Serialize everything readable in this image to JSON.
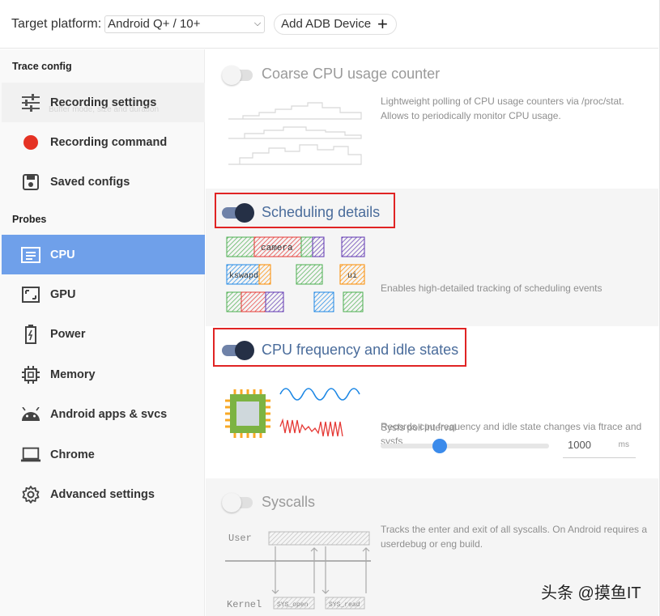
{
  "topbar": {
    "platform_label": "Target platform:",
    "platform_value": "Android Q+ / 10+",
    "add_adb_label": "Add ADB Device"
  },
  "sidebar": {
    "trace_config_title": "Trace config",
    "probes_title": "Probes",
    "ghost_subtitle": "Buffer mode, size and duration",
    "trace_items": [
      {
        "label": "Recording settings",
        "icon": "sliders-icon"
      },
      {
        "label": "Recording command",
        "icon": "record-dot-icon"
      },
      {
        "label": "Saved configs",
        "icon": "save-icon"
      }
    ],
    "probe_items": [
      {
        "label": "CPU",
        "icon": "cpu-icon",
        "active": true
      },
      {
        "label": "GPU",
        "icon": "gpu-icon"
      },
      {
        "label": "Power",
        "icon": "battery-icon"
      },
      {
        "label": "Memory",
        "icon": "memory-chip-icon"
      },
      {
        "label": "Android apps & svcs",
        "icon": "android-icon"
      },
      {
        "label": "Chrome",
        "icon": "laptop-icon"
      },
      {
        "label": "Advanced settings",
        "icon": "gear-icon"
      }
    ]
  },
  "probes": {
    "coarse": {
      "title": "Coarse CPU usage counter",
      "enabled": false,
      "description": "Lightweight polling of CPU usage counters via /proc/stat. Allows to periodically monitor CPU usage."
    },
    "scheduling": {
      "title": "Scheduling details",
      "enabled": true,
      "description": "Enables high-detailed tracking of scheduling events",
      "illus_labels": [
        "camera",
        "kswapd",
        "ui"
      ]
    },
    "cpufreq": {
      "title": "CPU frequency and idle states",
      "enabled": true,
      "description": "Records cpu frequency and idle state changes via ftrace and sysfs",
      "poll_label": "Sysfs poll interval",
      "poll_value": "1000",
      "poll_unit": "ms",
      "slider_fraction": 0.35
    },
    "syscalls": {
      "title": "Syscalls",
      "enabled": false,
      "description": "Tracks the enter and exit of all syscalls. On Android requires a userdebug or eng build.",
      "illus_labels": [
        "User",
        "Kernel",
        "SYS_open",
        "SYS_read"
      ]
    }
  },
  "watermark": "头条 @摸鱼IT",
  "colors": {
    "active_nav": "#6fa0ea",
    "toggle_on_knob": "#253046",
    "highlight_box": "#e02424",
    "title_on": "#4a6c9b"
  }
}
